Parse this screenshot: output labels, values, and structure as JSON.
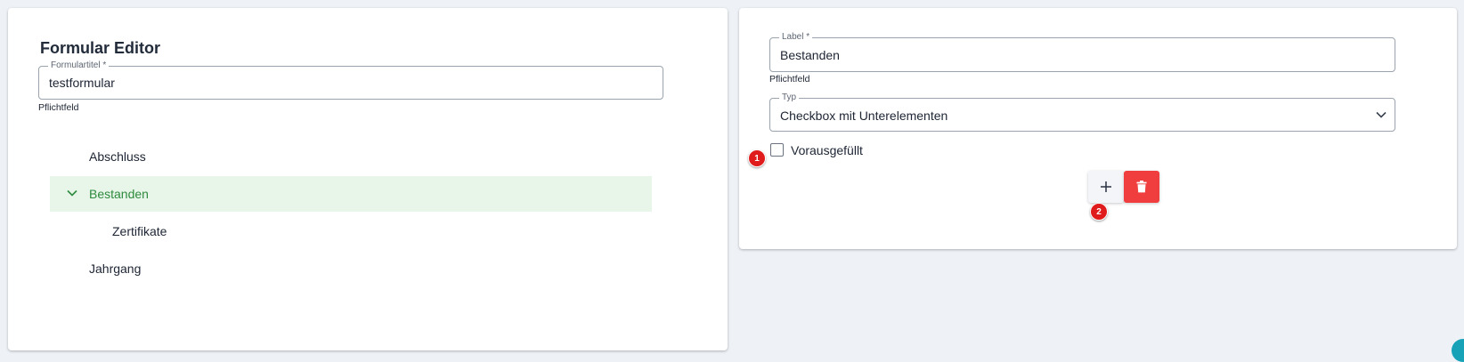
{
  "left_panel": {
    "title": "Formular Editor",
    "form_title_field": {
      "label": "Formulartitel *",
      "value": "testformular",
      "helper": "Pflichtfeld"
    },
    "tree": {
      "items": [
        {
          "label": "Abschluss",
          "level": 0,
          "selected": false,
          "expanded": false
        },
        {
          "label": "Bestanden",
          "level": 0,
          "selected": true,
          "expanded": true
        },
        {
          "label": "Zertifikate",
          "level": 1,
          "selected": false,
          "expanded": false
        },
        {
          "label": "Jahrgang",
          "level": 0,
          "selected": false,
          "expanded": false
        }
      ]
    }
  },
  "right_panel": {
    "label_field": {
      "label": "Label *",
      "value": "Bestanden",
      "helper": "Pflichtfeld"
    },
    "type_field": {
      "label": "Typ",
      "value": "Checkbox mit Unterelementen"
    },
    "prefilled_checkbox": {
      "label": "Vorausgefüllt",
      "checked": false
    },
    "buttons": {
      "add_icon": "plus-icon",
      "delete_icon": "trash-icon"
    }
  },
  "badges": [
    "1",
    "2"
  ],
  "colors": {
    "page_background": "#eef2f7",
    "selected_row_background": "#e8f5e9",
    "selected_row_text": "#2e8b3e",
    "delete_button": "#f03d3d",
    "badge": "#e01b1b"
  }
}
